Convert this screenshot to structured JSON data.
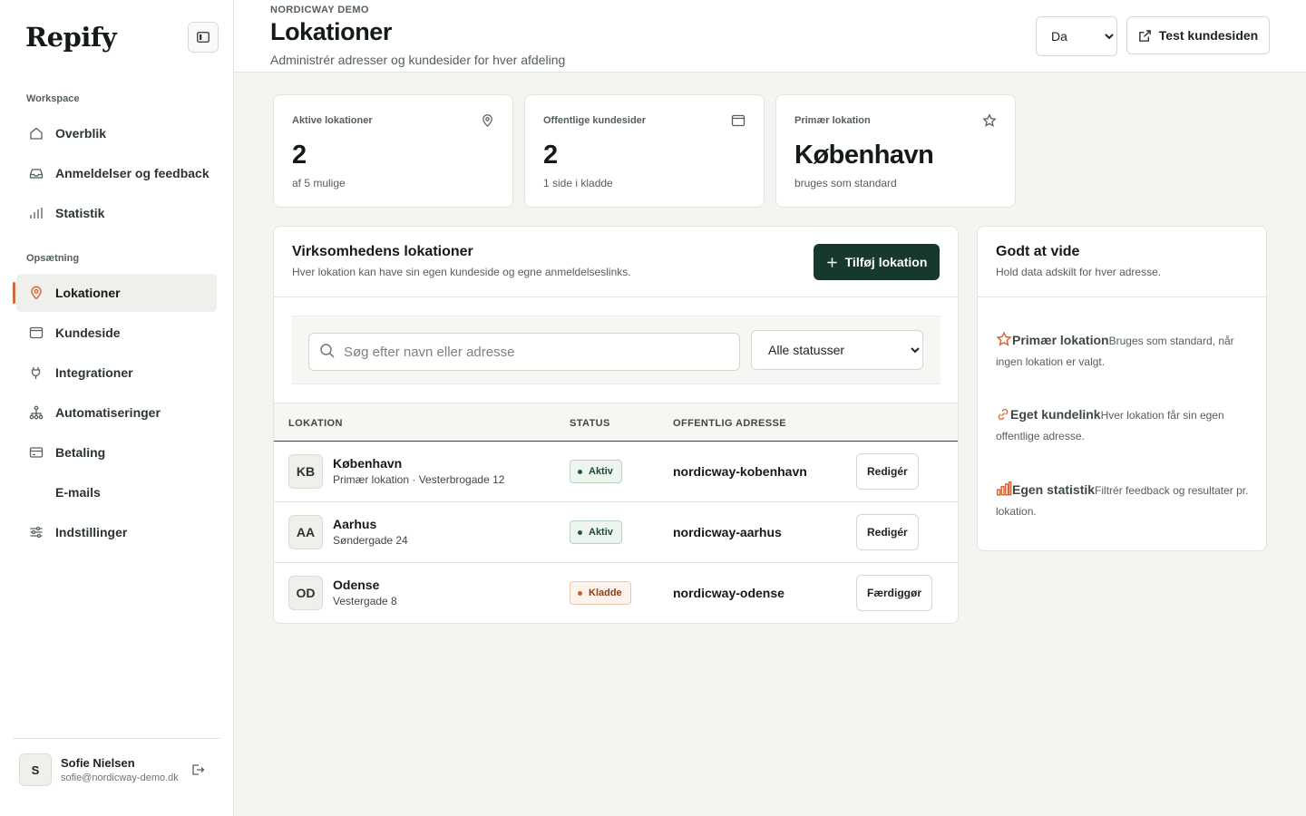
{
  "brand": {
    "name": "Repify",
    "accent": "#d9663a",
    "primary": "#17382c"
  },
  "sidebar": {
    "sections": [
      {
        "label": "Workspace"
      },
      {
        "label": "Opsætning"
      }
    ],
    "items": [
      {
        "label": "Overblik",
        "icon": "home-icon"
      },
      {
        "label": "Anmeldelser og feedback",
        "icon": "inbox-icon"
      },
      {
        "label": "Statistik",
        "icon": "bar-chart-icon"
      },
      {
        "label": "Lokationer",
        "icon": "map-pin-icon",
        "active": true
      },
      {
        "label": "Kundeside",
        "icon": "browser-icon"
      },
      {
        "label": "Integrationer",
        "icon": "plug-icon"
      },
      {
        "label": "Automatiseringer",
        "icon": "workflow-icon"
      },
      {
        "label": "Betaling",
        "icon": "credit-card-icon"
      },
      {
        "label": "E-mails",
        "icon": ""
      },
      {
        "label": "Indstillinger",
        "icon": "sliders-icon"
      }
    ],
    "user": {
      "initial": "S",
      "name": "Sofie Nielsen",
      "email": "sofie@nordicway-demo.dk"
    }
  },
  "header": {
    "eyebrow": "NORDICWAY DEMO",
    "title": "Lokationer",
    "subtitle": "Administrér adresser og kundesider for hver afdeling",
    "language": "Da",
    "test_button": "Test kundesiden"
  },
  "stats": [
    {
      "label": "Aktive lokationer",
      "value": "2",
      "sub": "af 5 mulige",
      "icon": "map-pin-icon"
    },
    {
      "label": "Offentlige kundesider",
      "value": "2",
      "sub": "1 side i kladde",
      "icon": "browser-icon"
    },
    {
      "label": "Primær lokation",
      "value": "København",
      "sub": "bruges som standard",
      "icon": "star-icon"
    }
  ],
  "locations_panel": {
    "title": "Virksomhedens lokationer",
    "subtitle": "Hver lokation kan have sin egen kundeside og egne anmeldelseslinks.",
    "add_button": "Tilføj lokation",
    "search_placeholder": "Søg efter navn eller adresse",
    "status_filter": "Alle statusser",
    "columns": [
      "LOKATION",
      "STATUS",
      "OFFENTLIG ADRESSE"
    ],
    "rows": [
      {
        "initials": "KB",
        "name": "København",
        "sub": "Primær lokation · Vesterbrogade 12",
        "status": "Aktiv",
        "address": "nordicway-kobenhavn",
        "action": "Redigér"
      },
      {
        "initials": "AA",
        "name": "Aarhus",
        "sub": "Søndergade 24",
        "status": "Aktiv",
        "address": "nordicway-aarhus",
        "action": "Redigér"
      },
      {
        "initials": "OD",
        "name": "Odense",
        "sub": "Vestergade 8",
        "status": "Kladde",
        "address": "nordicway-odense",
        "action": "Færdiggør"
      }
    ]
  },
  "info_panel": {
    "title": "Godt at vide",
    "subtitle": "Hold data adskilt for hver adresse.",
    "items": [
      {
        "title": "Primær lokation",
        "text": "Bruges som standard, når ingen lokation er valgt.",
        "icon": "star-icon"
      },
      {
        "title": "Eget kundelink",
        "text": "Hver lokation får sin egen offentlige adresse.",
        "icon": "link-icon"
      },
      {
        "title": "Egen statistik",
        "text": "Filtrér feedback og resultater pr. lokation.",
        "icon": "bar-chart-icon"
      }
    ]
  }
}
